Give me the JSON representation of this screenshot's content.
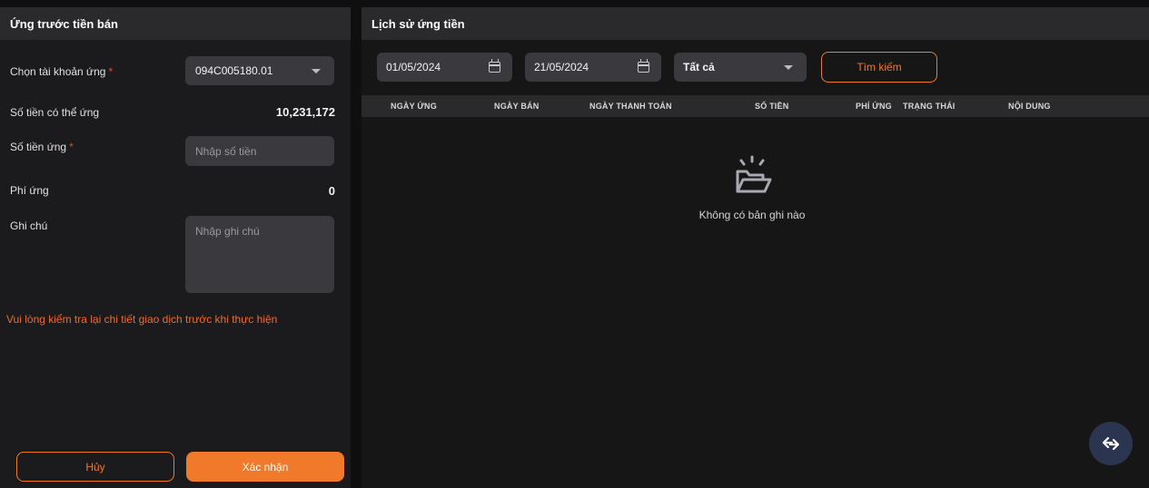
{
  "left": {
    "title": "Ứng trước tiền bán",
    "account_label": "Chọn tài khoản ứng",
    "required_mark": "*",
    "account_value": "094C005180.01",
    "available_label": "Số tiền có thể ứng",
    "available_value": "10,231,172",
    "amount_label": "Số tiền ứng",
    "amount_placeholder": "Nhập số tiền",
    "fee_label": "Phí ứng",
    "fee_value": "0",
    "note_label": "Ghi chú",
    "note_placeholder": "Nhập ghi chú",
    "warning": "Vui lòng kiểm tra lại chi tiết giao dịch trước khi thực hiện",
    "cancel_label": "Hủy",
    "confirm_label": "Xác nhận"
  },
  "right": {
    "title": "Lịch sử ứng tiền",
    "from_date": "01/05/2024",
    "to_date": "21/05/2024",
    "status_value": "Tất cả",
    "search_label": "Tìm kiếm",
    "columns": [
      "NGÀY ỨNG",
      "NGÀY BÁN",
      "NGÀY THANH TOÁN",
      "SỐ TIỀN",
      "PHÍ ỨNG",
      "TRẠNG THÁI",
      "NỘI DUNG"
    ],
    "empty_text": "Không có bản ghi nào"
  },
  "colors": {
    "accent": "#f07a2a",
    "required": "#e04a3a",
    "fab": "#2c3550"
  },
  "icons": {
    "date": "calendar-icon",
    "dropdown": "chevron-down-icon",
    "empty": "open-folder-icon",
    "fab": "swap-arrows-icon"
  }
}
